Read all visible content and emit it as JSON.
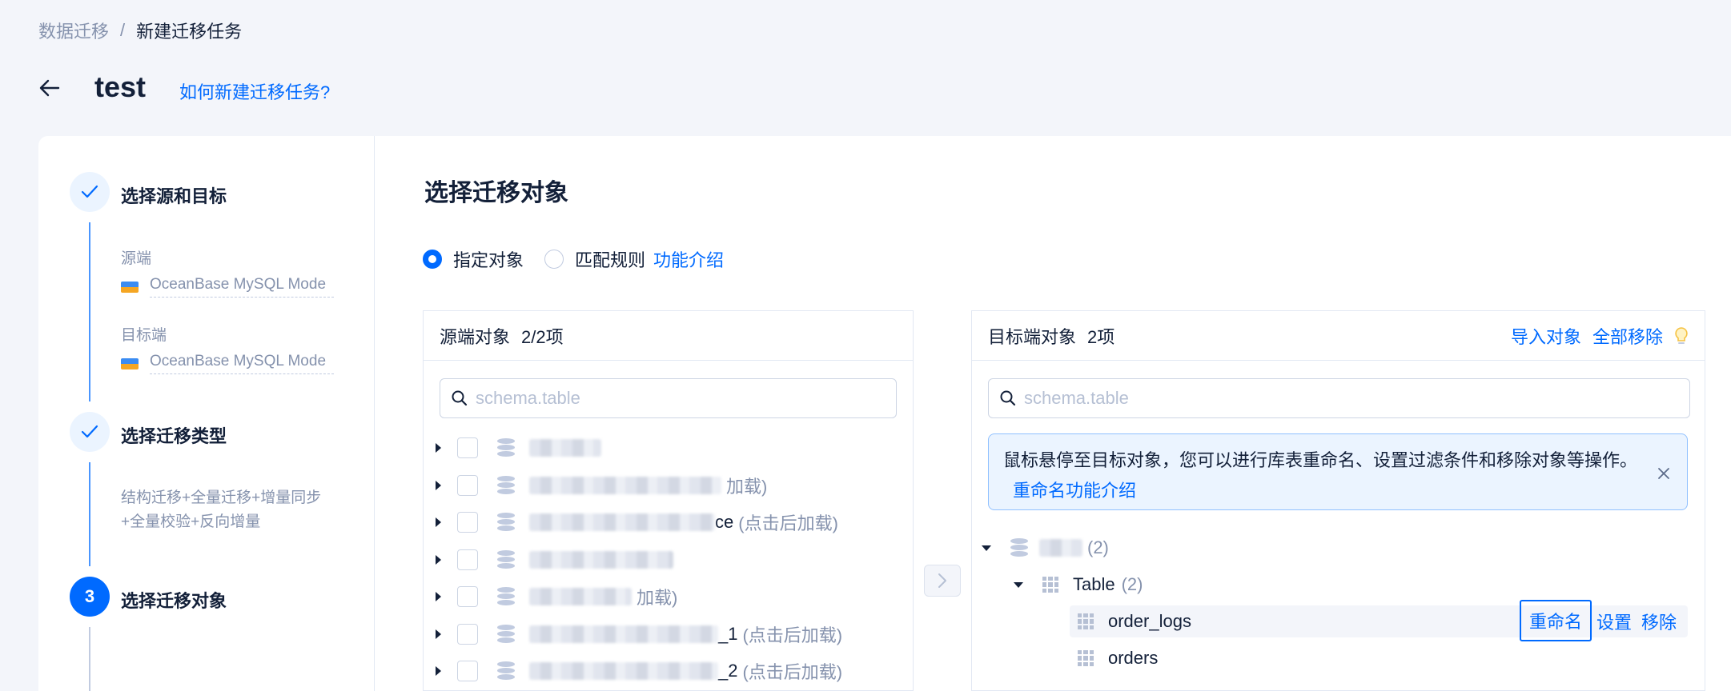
{
  "breadcrumb": {
    "parent": "数据迁移",
    "separator": "/",
    "current": "新建迁移任务"
  },
  "header": {
    "title": "test",
    "help_link": "如何新建迁移任务?"
  },
  "steps": [
    {
      "title": "选择源和目标",
      "source_label": "源端",
      "source_value": "OceanBase MySQL Mode",
      "target_label": "目标端",
      "target_value": "OceanBase MySQL Mode"
    },
    {
      "title": "选择迁移类型",
      "desc_line1": "结构迁移+全量迁移+增量同步",
      "desc_line2": "+全量校验+反向增量"
    },
    {
      "number": "3",
      "title": "选择迁移对象"
    }
  ],
  "main": {
    "title": "选择迁移对象",
    "mode_options": [
      {
        "label": "指定对象",
        "selected": true
      },
      {
        "label": "匹配规则",
        "selected": false
      }
    ],
    "feature_link": "功能介绍"
  },
  "source_panel": {
    "title": "源端对象",
    "count": "2/2项",
    "search_placeholder": "schema.table",
    "rows": [
      {
        "visible_text": "",
        "suffix": ""
      },
      {
        "visible_text": "",
        "suffix": "加载)"
      },
      {
        "visible_text": "ce",
        "suffix": "(点击后加载)"
      },
      {
        "visible_text": "",
        "suffix": ""
      },
      {
        "visible_text": "",
        "suffix": "加载)"
      },
      {
        "visible_text": "_1",
        "suffix": "(点击后加载)"
      },
      {
        "visible_text": "_2",
        "suffix": "(点击后加载)"
      }
    ]
  },
  "target_panel": {
    "title": "目标端对象",
    "count": "2项",
    "import_link": "导入对象",
    "remove_all_link": "全部移除",
    "search_placeholder": "schema.table",
    "alert_text": "鼠标悬停至目标对象，您可以进行库表重命名、设置过滤条件和移除对象等操作。",
    "alert_link": "重命名功能介绍",
    "tree": {
      "db_count": "(2)",
      "group_name": "Table",
      "group_count": "(2)",
      "tables": [
        "order_logs",
        "orders"
      ]
    },
    "row_actions": {
      "rename": "重命名",
      "settings": "设置",
      "remove": "移除"
    }
  },
  "icons": {
    "back": "arrow-left-icon",
    "check": "check-icon",
    "search": "search-icon",
    "close": "close-icon",
    "bulb": "lightbulb-icon",
    "transfer": "chevron-right-icon",
    "database": "database-icon",
    "table": "table-icon"
  },
  "colors": {
    "primary": "#006aff",
    "text": "#132039",
    "muted": "#8592ad",
    "alert_bg": "#ebf4ff"
  }
}
